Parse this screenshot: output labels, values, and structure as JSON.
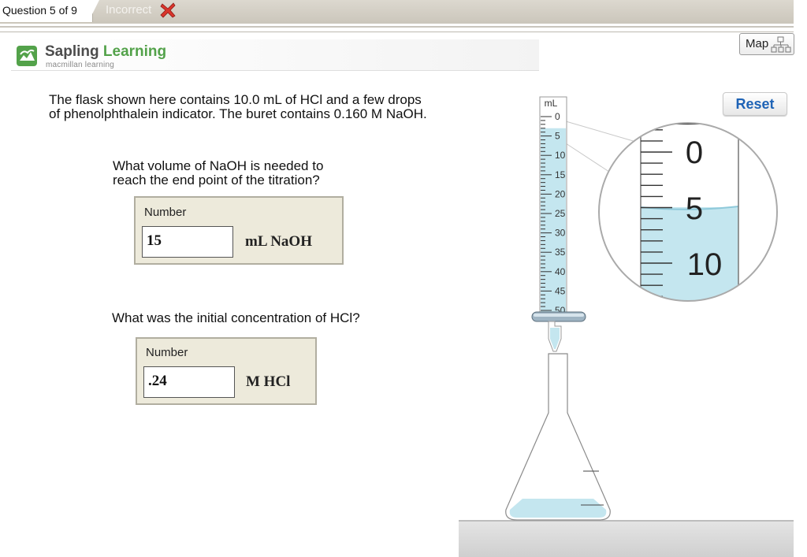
{
  "nav": {
    "question_label": "Question 5 of 9",
    "status": "Incorrect"
  },
  "brand": {
    "name_part1": "Sapling ",
    "name_part2": "Learning",
    "subtitle": "macmillan learning"
  },
  "toolbar": {
    "map_label": "Map",
    "reset_label": "Reset"
  },
  "problem": {
    "intro_line1": "The flask shown here contains 10.0 mL of HCl and a few drops",
    "intro_line2": "of phenolphthalein indicator. The buret contains 0.160 M NaOH.",
    "question1_line1": "What volume of NaOH is needed to",
    "question1_line2": "reach the end point of the titration?",
    "question2": "What was the initial concentration of HCl?"
  },
  "answers": [
    {
      "label": "Number",
      "value": "15",
      "unit": "mL  NaOH"
    },
    {
      "label": "Number",
      "value": ".24",
      "unit": "M  HCl"
    }
  ],
  "buret": {
    "unit_label": "mL",
    "scale_labels": [
      "0",
      "5",
      "10",
      "15",
      "20",
      "25",
      "30",
      "35",
      "40",
      "45",
      "50"
    ],
    "liquid_level_ml": 3,
    "magnifier_labels": [
      "0",
      "5",
      "10"
    ]
  },
  "colors": {
    "liquid": "#c4e6ef",
    "accent_blue": "#1e63b6",
    "brand_green": "#53a24a",
    "incorrect_red": "#d9342b"
  }
}
